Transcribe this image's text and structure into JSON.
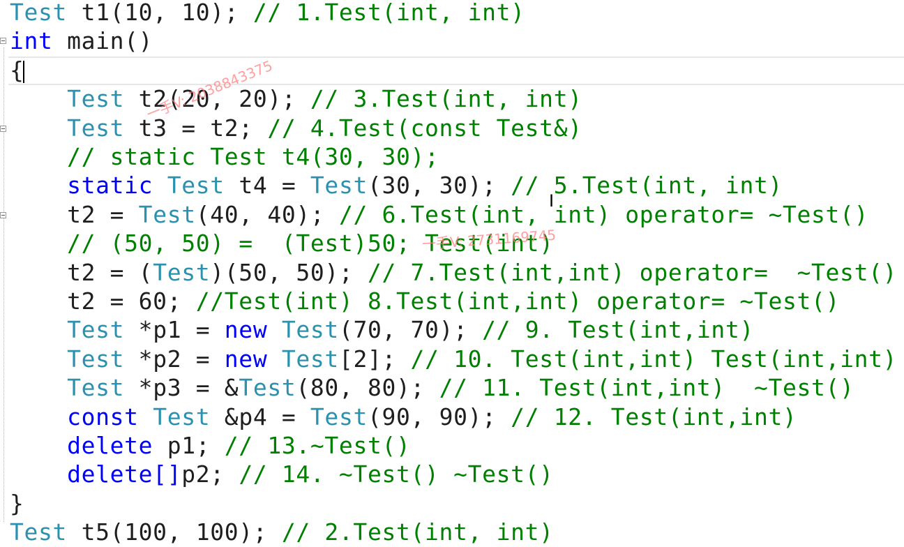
{
  "editor": {
    "lines": [
      {
        "tokens": [
          {
            "t": "Test",
            "k": "type"
          },
          {
            "t": " t1(10, 10); ",
            "k": "plain"
          },
          {
            "t": "// 1.Test(int, int)",
            "k": "comment"
          }
        ]
      },
      {
        "tokens": [
          {
            "t": "int",
            "k": "kw"
          },
          {
            "t": " main()",
            "k": "plain"
          }
        ]
      },
      {
        "tokens": [
          {
            "t": "{",
            "k": "plain"
          }
        ]
      },
      {
        "tokens": [
          {
            "t": "    ",
            "k": "plain"
          },
          {
            "t": "Test",
            "k": "type"
          },
          {
            "t": " t2(20, 20); ",
            "k": "plain"
          },
          {
            "t": "// 3.Test(int, int)",
            "k": "comment"
          }
        ]
      },
      {
        "tokens": [
          {
            "t": "    ",
            "k": "plain"
          },
          {
            "t": "Test",
            "k": "type"
          },
          {
            "t": " t3 = t2; ",
            "k": "plain"
          },
          {
            "t": "// 4.Test(const Test&)",
            "k": "comment"
          }
        ]
      },
      {
        "tokens": [
          {
            "t": "    ",
            "k": "plain"
          },
          {
            "t": "// static Test t4(30, 30);",
            "k": "comment"
          }
        ]
      },
      {
        "tokens": [
          {
            "t": "    ",
            "k": "plain"
          },
          {
            "t": "static",
            "k": "kw"
          },
          {
            "t": " ",
            "k": "plain"
          },
          {
            "t": "Test",
            "k": "type"
          },
          {
            "t": " t4 = ",
            "k": "plain"
          },
          {
            "t": "Test",
            "k": "type"
          },
          {
            "t": "(30, 30); ",
            "k": "plain"
          },
          {
            "t": "// 5.Test(int, int)",
            "k": "comment"
          }
        ]
      },
      {
        "tokens": [
          {
            "t": "    ",
            "k": "plain"
          },
          {
            "t": "t2 = ",
            "k": "plain"
          },
          {
            "t": "Test",
            "k": "type"
          },
          {
            "t": "(40, 40); ",
            "k": "plain"
          },
          {
            "t": "// 6.Test(int, int) operator= ~Test()",
            "k": "comment"
          }
        ]
      },
      {
        "tokens": [
          {
            "t": "    ",
            "k": "plain"
          },
          {
            "t": "// (50, 50) =  (Test)50; Test(int)",
            "k": "comment"
          }
        ]
      },
      {
        "tokens": [
          {
            "t": "    ",
            "k": "plain"
          },
          {
            "t": "t2 = (",
            "k": "plain"
          },
          {
            "t": "Test",
            "k": "type"
          },
          {
            "t": ")(50, 50); ",
            "k": "plain"
          },
          {
            "t": "// 7.Test(int,int) operator=  ~Test()",
            "k": "comment"
          }
        ]
      },
      {
        "tokens": [
          {
            "t": "    ",
            "k": "plain"
          },
          {
            "t": "t2 = 60; ",
            "k": "plain"
          },
          {
            "t": "//Test(int) 8.Test(int,int) operator= ~Test()",
            "k": "comment"
          }
        ]
      },
      {
        "tokens": [
          {
            "t": "    ",
            "k": "plain"
          },
          {
            "t": "Test",
            "k": "type"
          },
          {
            "t": " *p1 = ",
            "k": "plain"
          },
          {
            "t": "new",
            "k": "kw"
          },
          {
            "t": " ",
            "k": "plain"
          },
          {
            "t": "Test",
            "k": "type"
          },
          {
            "t": "(70, 70); ",
            "k": "plain"
          },
          {
            "t": "// 9. Test(int,int)",
            "k": "comment"
          }
        ]
      },
      {
        "tokens": [
          {
            "t": "    ",
            "k": "plain"
          },
          {
            "t": "Test",
            "k": "type"
          },
          {
            "t": " *p2 = ",
            "k": "plain"
          },
          {
            "t": "new",
            "k": "kw"
          },
          {
            "t": " ",
            "k": "plain"
          },
          {
            "t": "Test",
            "k": "type"
          },
          {
            "t": "[2]; ",
            "k": "plain"
          },
          {
            "t": "// 10. Test(int,int) Test(int,int)",
            "k": "comment"
          }
        ]
      },
      {
        "tokens": [
          {
            "t": "    ",
            "k": "plain"
          },
          {
            "t": "Test",
            "k": "type"
          },
          {
            "t": " *p3 = &",
            "k": "plain"
          },
          {
            "t": "Test",
            "k": "type"
          },
          {
            "t": "(80, 80); ",
            "k": "plain"
          },
          {
            "t": "// 11. Test(int,int)  ~Test()",
            "k": "comment"
          }
        ]
      },
      {
        "tokens": [
          {
            "t": "    ",
            "k": "plain"
          },
          {
            "t": "const",
            "k": "kw"
          },
          {
            "t": " ",
            "k": "plain"
          },
          {
            "t": "Test",
            "k": "type"
          },
          {
            "t": " &p4 = ",
            "k": "plain"
          },
          {
            "t": "Test",
            "k": "type"
          },
          {
            "t": "(90, 90); ",
            "k": "plain"
          },
          {
            "t": "// 12. Test(int,int)",
            "k": "comment"
          }
        ]
      },
      {
        "tokens": [
          {
            "t": "    ",
            "k": "plain"
          },
          {
            "t": "delete",
            "k": "kw"
          },
          {
            "t": " p1; ",
            "k": "plain"
          },
          {
            "t": "// 13.~Test()",
            "k": "comment"
          }
        ]
      },
      {
        "tokens": [
          {
            "t": "    ",
            "k": "plain"
          },
          {
            "t": "delete[]",
            "k": "kw"
          },
          {
            "t": "p2; ",
            "k": "plain"
          },
          {
            "t": "// 14. ~Test() ~Test()",
            "k": "comment"
          }
        ]
      },
      {
        "tokens": [
          {
            "t": "}",
            "k": "plain"
          }
        ]
      },
      {
        "tokens": [
          {
            "t": "Test",
            "k": "type"
          },
          {
            "t": " t5(100, 100); ",
            "k": "plain"
          },
          {
            "t": "// 2.Test(int, int)",
            "k": "comment"
          }
        ]
      }
    ]
  },
  "watermarks": {
    "wm1": "一手V: 2038843375",
    "wm2": "一手V: 2731169745"
  },
  "colors": {
    "type": "#2b91af",
    "keyword": "#0000ff",
    "comment": "#008000",
    "plain": "#1e1e1e",
    "watermark": "#ff7f7f"
  }
}
